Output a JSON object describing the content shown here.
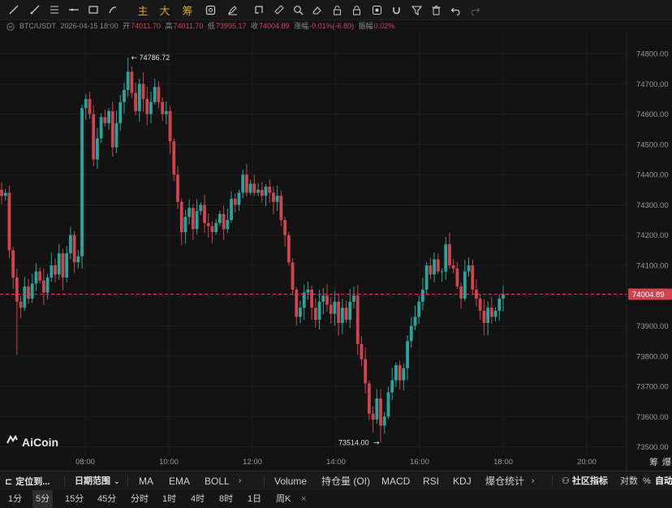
{
  "toolbar": {
    "tools": [
      "trend-line",
      "horizontal-line",
      "parallel-channel",
      "horizontal-ray",
      "rectangle",
      "brush",
      "main-chart",
      "big-chart",
      "chip-distribution",
      "screenshot",
      "text-note",
      "ruler",
      "magnifier",
      "eraser",
      "lock",
      "eye",
      "magnet",
      "filter",
      "trash",
      "undo",
      "redo"
    ],
    "main_label": "主",
    "big_label": "大",
    "chip_label": "筹"
  },
  "info": {
    "symbol": "BTC/USDT",
    "datetime": "2026-04-15 18:00",
    "open_label": "开",
    "open": "74011.70",
    "high_label": "高",
    "high": "74011.70",
    "low_label": "低",
    "low": "73995.17",
    "close_label": "收",
    "close": "74004.89",
    "change_label": "涨幅",
    "change": "-0.01%(-6.80)",
    "amp_label": "振幅",
    "amp": "0.02%"
  },
  "colors": {
    "up": "#26a69a",
    "down": "#d1434e",
    "background": "#131313",
    "price_tag": "#d1434e"
  },
  "chart_data": {
    "type": "candlestick",
    "y_ticks": [
      "74800.00",
      "74700.00",
      "74600.00",
      "74500.00",
      "74400.00",
      "74300.00",
      "74200.00",
      "74100.00",
      "74000.00",
      "73900.00",
      "73800.00",
      "73700.00",
      "73600.00",
      "73500.00"
    ],
    "x_ticks": [
      "08:00",
      "10:00",
      "12:00",
      "14:00",
      "16:00",
      "18:00",
      "20:00"
    ],
    "ylim": [
      73475,
      74870
    ],
    "current_price": "74004.89",
    "max_label": "74786.72",
    "min_label": "73514.00",
    "max_value": 74786.72,
    "min_value": 73514.0,
    "max_index": 33,
    "min_index": 99,
    "close_series": [
      74330,
      74340,
      74150,
      74060,
      73980,
      73960,
      74030,
      73990,
      74040,
      74080,
      74050,
      74010,
      74060,
      74100,
      74070,
      74140,
      74060,
      74140,
      74200,
      74110,
      74130,
      74620,
      74650,
      74600,
      74450,
      74520,
      74590,
      74570,
      74610,
      74490,
      74570,
      74640,
      74680,
      74740,
      74670,
      74610,
      74700,
      74650,
      74600,
      74640,
      74690,
      74640,
      74600,
      74610,
      74510,
      74400,
      74310,
      74210,
      74260,
      74290,
      74220,
      74280,
      74300,
      74240,
      74230,
      74210,
      74240,
      74270,
      74220,
      74250,
      74320,
      74300,
      74340,
      74400,
      74340,
      74370,
      74340,
      74350,
      74330,
      74360,
      74340,
      74310,
      74330,
      74250,
      74200,
      74110,
      74020,
      73930,
      73960,
      74010,
      74020,
      73960,
      73920,
      73980,
      74000,
      73970,
      73940,
      73980,
      73910,
      73960,
      73920,
      73980,
      74000,
      73840,
      73790,
      73710,
      73610,
      73590,
      73660,
      73570,
      73600,
      73680,
      73720,
      73770,
      73720,
      73760,
      73850,
      73900,
      73930,
      73980,
      74020,
      74100,
      74070,
      74120,
      74080,
      74080,
      74170,
      74100,
      74090,
      74030,
      73990,
      74080,
      74100,
      74020,
      73990,
      73950,
      73910,
      73960,
      73930,
      73950,
      73990,
      74005
    ]
  },
  "watermark": "AiCoin",
  "bottom1": {
    "locate": "定位到...",
    "date_range": "日期范围",
    "indicators": [
      "MA",
      "EMA",
      "BOLL"
    ],
    "sub_indicators": [
      "Volume",
      "持仓量 (OI)",
      "MACD",
      "RSI",
      "KDJ",
      "爆仓统计"
    ],
    "community": "社区指标",
    "log": "对数",
    "percent": "%",
    "auto": "自动"
  },
  "bottom2": {
    "timeframes": [
      "1分",
      "5分",
      "15分",
      "45分",
      "分时",
      "1时",
      "4时",
      "8时",
      "1日",
      "周K"
    ],
    "active": "5分",
    "close": "×"
  },
  "right_side": {
    "chip": "筹",
    "blast": "爆"
  }
}
